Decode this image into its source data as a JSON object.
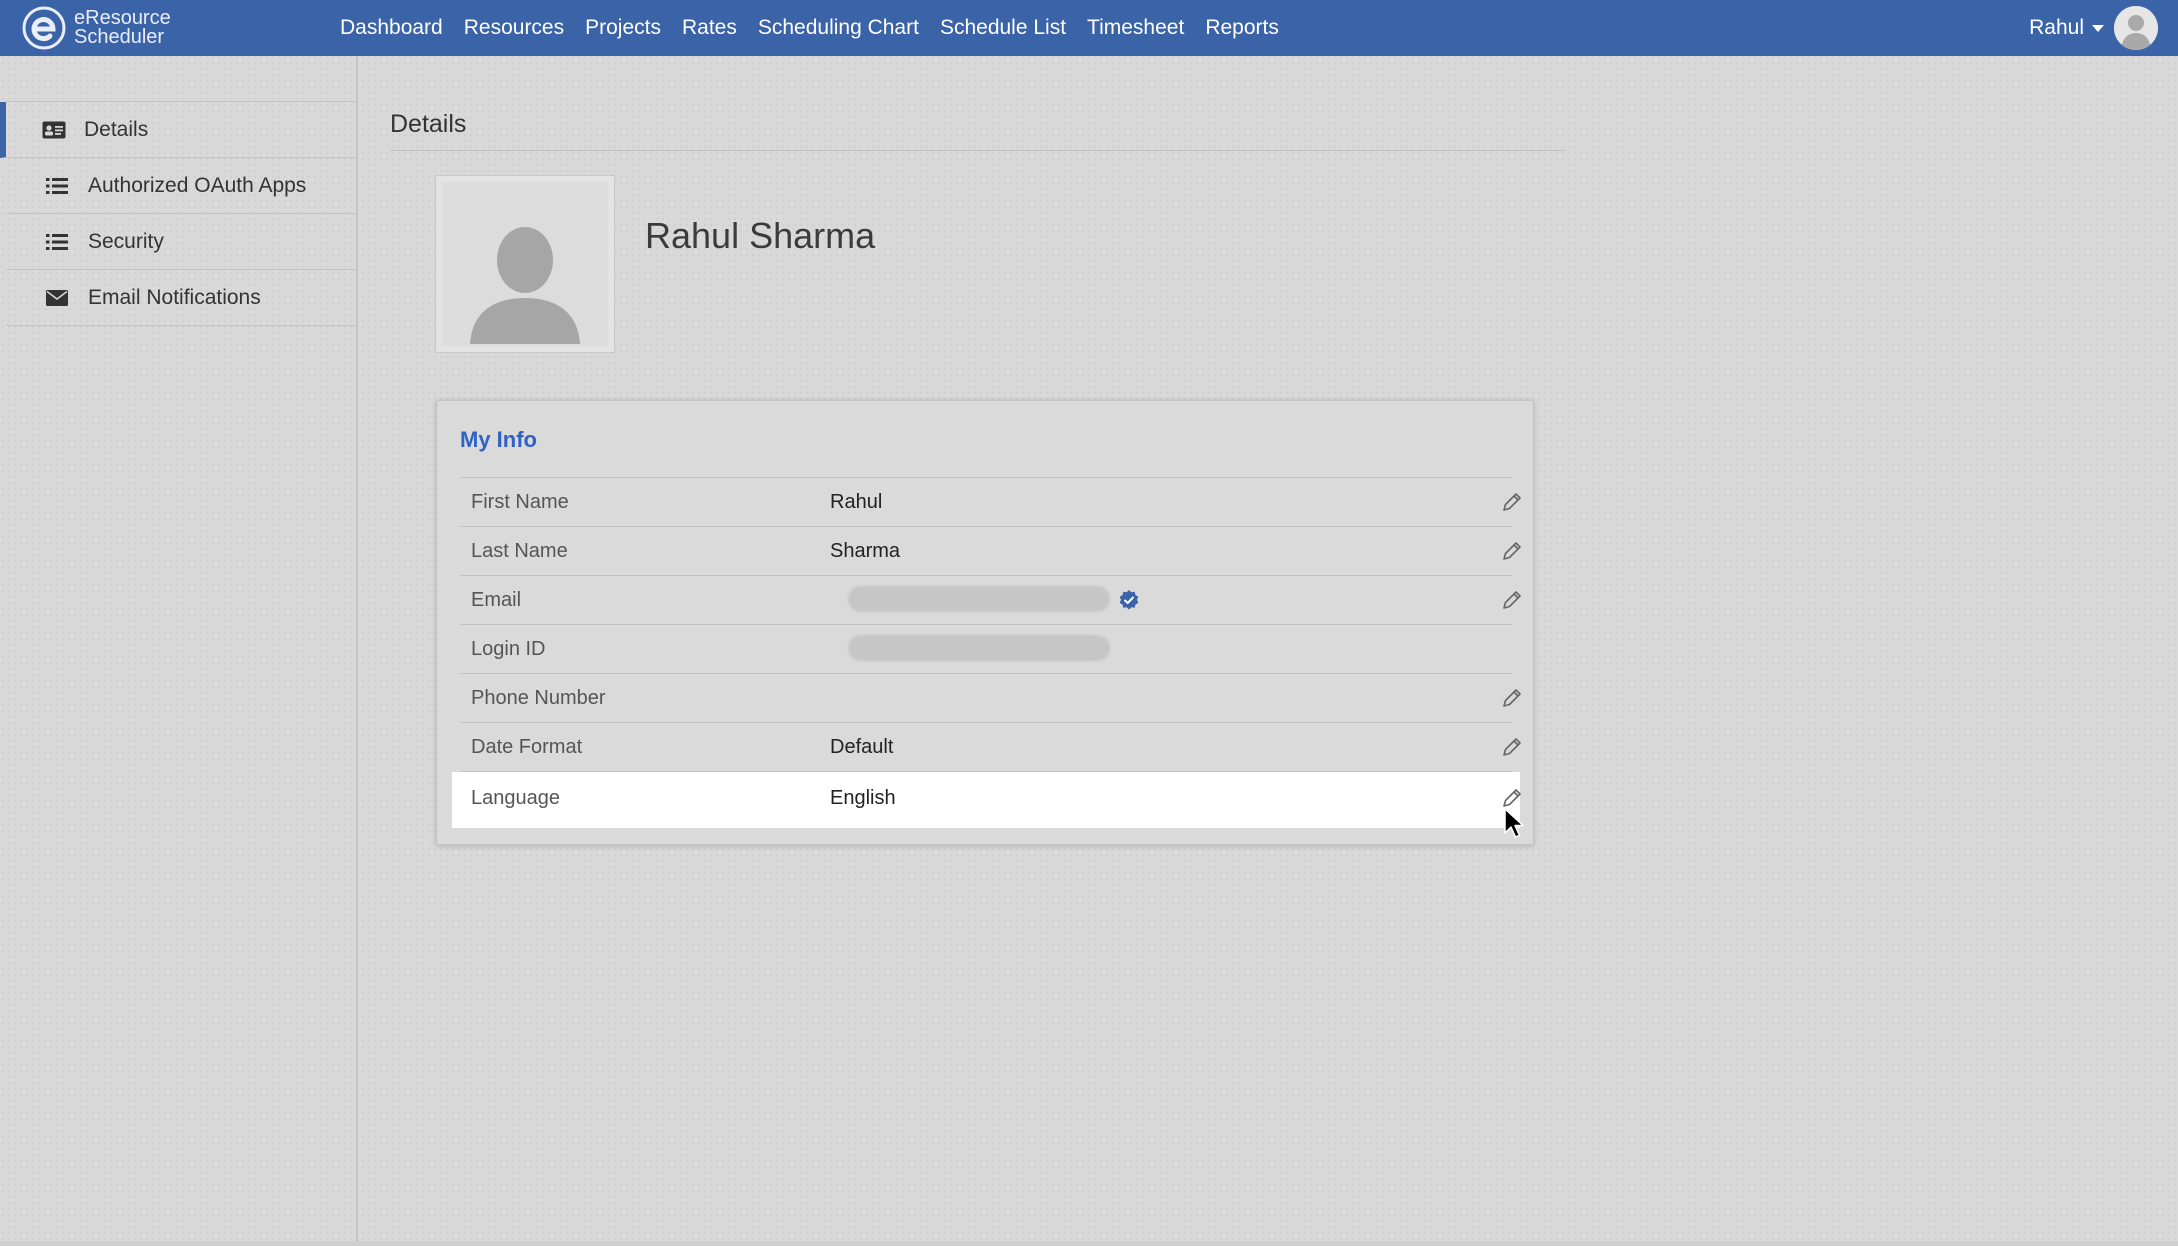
{
  "brand": {
    "line1": "eResource",
    "line2": "Scheduler",
    "icon": "e-logo-icon"
  },
  "nav": [
    {
      "label": "Dashboard"
    },
    {
      "label": "Resources"
    },
    {
      "label": "Projects"
    },
    {
      "label": "Rates"
    },
    {
      "label": "Scheduling Chart"
    },
    {
      "label": "Schedule List"
    },
    {
      "label": "Timesheet"
    },
    {
      "label": "Reports"
    }
  ],
  "user": {
    "name": "Rahul",
    "avatar_icon": "user-avatar-icon"
  },
  "sidebar": {
    "items": [
      {
        "label": "Details",
        "icon": "id-card-icon",
        "active": true
      },
      {
        "label": "Authorized OAuth Apps",
        "icon": "list-icon"
      },
      {
        "label": "Security",
        "icon": "list-icon"
      },
      {
        "label": "Email Notifications",
        "icon": "envelope-icon"
      }
    ]
  },
  "main": {
    "title": "Details",
    "profile_name": "Rahul Sharma",
    "card": {
      "title": "My Info",
      "rows": [
        {
          "label": "First Name",
          "value": "Rahul"
        },
        {
          "label": "Last Name",
          "value": "Sharma"
        },
        {
          "label": "Email",
          "value": ""
        },
        {
          "label": "Login ID",
          "value": ""
        },
        {
          "label": "Phone Number",
          "value": ""
        },
        {
          "label": "Date Format",
          "value": "Default"
        },
        {
          "label": "Language",
          "value": "English"
        }
      ]
    }
  },
  "colors": {
    "topbar": "#3a63a8",
    "accent": "#2f62c4",
    "verified": "#3a63a8"
  }
}
